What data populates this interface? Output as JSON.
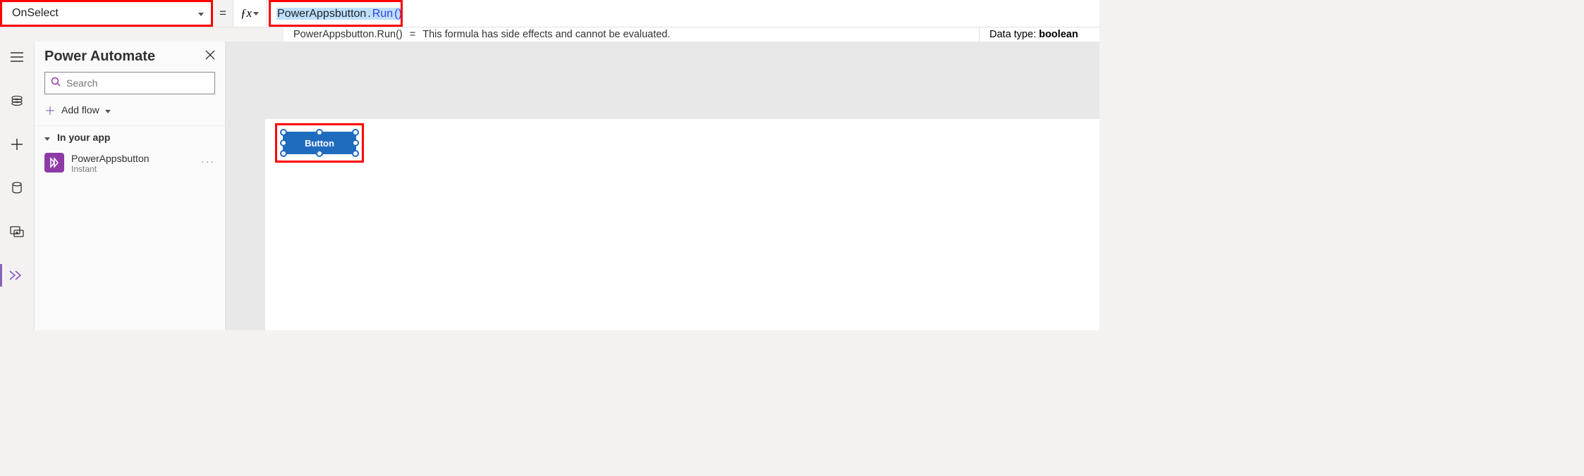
{
  "formulaBar": {
    "property": "OnSelect",
    "formula_identifier": "PowerAppsbutton",
    "formula_method": "Run",
    "formula_parens": "()"
  },
  "resultBar": {
    "echo": "PowerAppsbutton.Run()",
    "message": "This formula has side effects and cannot be evaluated.",
    "dataTypeLabel": "Data type:",
    "dataTypeValue": "boolean"
  },
  "sidePanel": {
    "title": "Power Automate",
    "searchPlaceholder": "Search",
    "addFlowLabel": "Add flow",
    "sectionLabel": "In your app",
    "flow": {
      "name": "PowerAppsbutton",
      "subtitle": "Instant"
    }
  },
  "canvas": {
    "buttonLabel": "Button"
  }
}
